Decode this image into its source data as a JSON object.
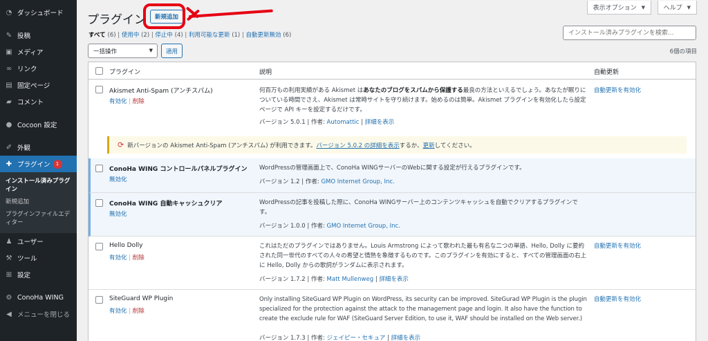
{
  "sidebar": {
    "items": [
      {
        "label": "ダッシュボード",
        "icon": "dashboard-icon"
      },
      {
        "label": "投稿",
        "icon": "pin-icon"
      },
      {
        "label": "メディア",
        "icon": "media-icon"
      },
      {
        "label": "リンク",
        "icon": "link-icon"
      },
      {
        "label": "固定ページ",
        "icon": "page-icon"
      },
      {
        "label": "コメント",
        "icon": "comment-icon"
      },
      {
        "label": "Cocoon 設定",
        "icon": "cocoon-icon"
      },
      {
        "label": "外観",
        "icon": "brush-icon"
      },
      {
        "label": "プラグイン",
        "icon": "plugin-icon",
        "badge": "1"
      },
      {
        "label": "ユーザー",
        "icon": "user-icon"
      },
      {
        "label": "ツール",
        "icon": "wrench-icon"
      },
      {
        "label": "設定",
        "icon": "settings-icon"
      },
      {
        "label": "ConoHa WING",
        "icon": "gear-icon"
      },
      {
        "label": "メニューを閉じる",
        "icon": "collapse-icon"
      }
    ],
    "submenu": [
      "インストール済みプラグイン",
      "新規追加",
      "プラグインファイルエディター"
    ]
  },
  "topbar": {
    "screen_options": "表示オプション",
    "help": "ヘルプ"
  },
  "page": {
    "title": "プラグイン",
    "add_new": "新規追加"
  },
  "filters": {
    "all": "すべて",
    "all_count": "(6)",
    "active": "使用中",
    "active_count": "(2)",
    "inactive": "停止中",
    "inactive_count": "(4)",
    "update": "利用可能な更新",
    "update_count": "(1)",
    "autoupdate_off": "自動更新無効",
    "autoupdate_off_count": "(6)",
    "sep": "|"
  },
  "search": {
    "placeholder": "インストール済みプラグインを検索..."
  },
  "bulk": {
    "selected": "一括操作",
    "apply": "適用"
  },
  "count": "6個の項目",
  "table": {
    "headers": {
      "plugin": "プラグイン",
      "desc": "説明",
      "auto": "自動更新"
    },
    "version_prefix": "バージョン",
    "author_prefix": "作者:",
    "details": "詳細を表示",
    "sep": "|"
  },
  "plugins": [
    {
      "name": "Akismet Anti-Spam (アンチスパム)",
      "action": "有効化",
      "delete": "削除",
      "desc_pre": "何百万もの利用実績がある Akismet は",
      "desc_bold": "あなたのブログをスパムから保護する",
      "desc_post": "最良の方法といえるでしょう。あなたが眠りについている時間でさえ、Akismet は常時サイトを守り続けます。始めるのは簡単。Akismet プラグインを有効化したら設定ページで API キーを設定するだけです。",
      "version": "5.0.1",
      "author": "Automattic",
      "auto": "自動更新を有効化"
    },
    {
      "name": "ConoHa WING コントロールパネルプラグイン",
      "action": "無効化",
      "desc": "WordPressの管理画面上で、ConoHa WINGサーバーのWebに関する設定が行えるプラグインです。",
      "version": "1.2",
      "author": "GMO Internet Group, Inc."
    },
    {
      "name": "ConoHa WING 自動キャッシュクリア",
      "action": "無効化",
      "desc": "WordPressの記事を投稿した際に、ConoHa WINGサーバー上のコンテンツキャッシュを自動でクリアするプラグインです。",
      "version": "1.0.0",
      "author": "GMO Internet Group, Inc."
    },
    {
      "name": "Hello Dolly",
      "action": "有効化",
      "delete": "削除",
      "desc": "これはただのプラグインではありません。Louis Armstrong によって歌われた最も有名な二つの単語、Hello, Dolly に要約された同一世代のすべての人々の希望と情熱を象徴するものです。このプラグインを有効にすると、すべての管理画面の右上に Hello, Dolly からの歌詞がランダムに表示されます。",
      "version": "1.7.2",
      "author": "Matt Mullenweg",
      "auto": "自動更新を有効化"
    },
    {
      "name": "SiteGuard WP Plugin",
      "action": "有効化",
      "delete": "削除",
      "desc": "Only installing SiteGuard WP Plugin on WordPress, its security can be improved. SiteGurad WP Plugin is the plugin specialized for the protection against the attack to the management page and login. It also have the function to create the exclude rule for WAF (SiteGuard Server Edition, to use it, WAF should be installed on the Web server.)",
      "version": "1.7.3",
      "author": "ジェイピー・セキュア",
      "auto": "自動更新を有効化"
    }
  ],
  "notice": {
    "pre": "新バージョンの Akismet Anti-Spam (アンチスパム) が利用できます。",
    "link1": "バージョン 5.0.2 の詳細を表示",
    "mid": "するか、",
    "link2": "更新",
    "post": "してください。"
  },
  "colors": {
    "sidebar": "#1d2327",
    "accent": "#2271b1",
    "annotation": "#e60012",
    "notice": "#dba617"
  }
}
